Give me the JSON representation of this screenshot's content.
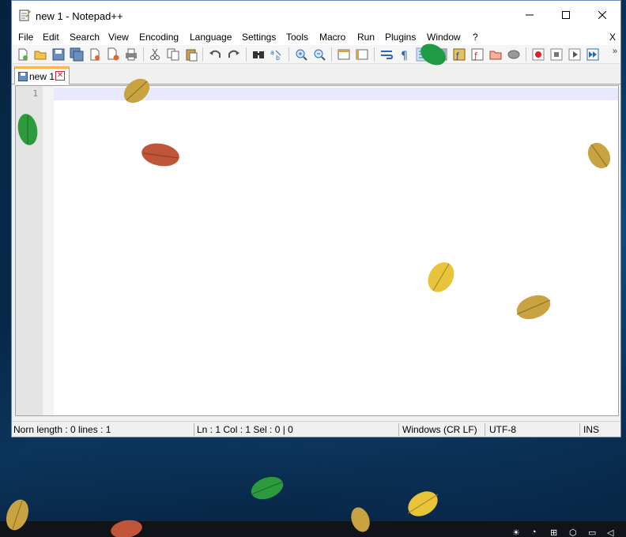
{
  "window": {
    "title": "new 1 - Notepad++",
    "minimize_icon": "minimize-icon",
    "maximize_icon": "maximize-icon",
    "close_icon": "close-icon"
  },
  "menu": {
    "items": [
      "File",
      "Edit",
      "Search",
      "View",
      "Encoding",
      "Language",
      "Settings",
      "Tools",
      "Macro",
      "Run",
      "Plugins",
      "Window",
      "?"
    ],
    "close_label": "X"
  },
  "toolbar": {
    "icons": [
      "new-file-icon",
      "open-file-icon",
      "save-icon",
      "save-all-icon",
      "close-file-icon",
      "close-all-icon",
      "print-icon",
      "cut-icon",
      "copy-icon",
      "paste-icon",
      "undo-icon",
      "redo-icon",
      "find-icon",
      "replace-icon",
      "zoom-in-icon",
      "zoom-out-icon",
      "sync-vertical-icon",
      "sync-horizontal-icon",
      "word-wrap-icon",
      "show-all-characters-icon",
      "indent-guide-icon",
      "document-map-icon",
      "function-list-icon",
      "folder-as-workspace-icon",
      "monitoring-icon",
      "record-macro-icon",
      "stop-recording-icon",
      "play-macro-icon",
      "run-macro-multiple-icon"
    ],
    "more_label": "»"
  },
  "tabs": [
    {
      "label": "new 1",
      "close_icon": "tab-close-icon"
    }
  ],
  "editor": {
    "line_numbers": [
      "1"
    ],
    "content": ""
  },
  "status": {
    "doc_info": "Norn length : 0    lines : 1",
    "position": "Ln : 1    Col : 1    Sel : 0 | 0",
    "eol": "Windows (CR LF)",
    "encoding": "UTF-8",
    "mode": "INS"
  },
  "colors": {
    "accent_tab": "#fab64d",
    "current_line": "#e8e8ff",
    "gutter": "#e4e4e4",
    "desktop": "#0e3a66"
  }
}
